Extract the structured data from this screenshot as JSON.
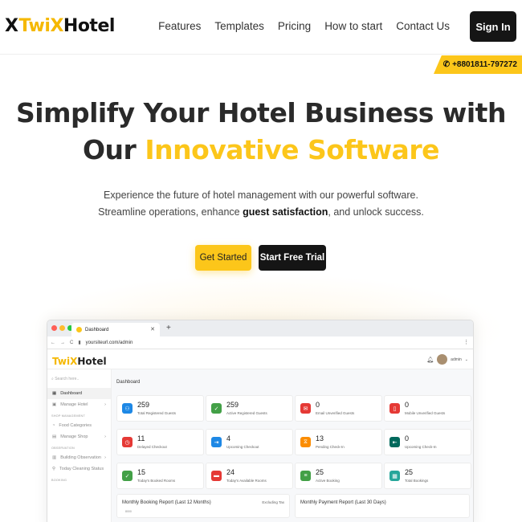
{
  "brand": {
    "logo_mark": "X",
    "logo_twix": "Twi",
    "logo_x": "X",
    "logo_hotel": "Hotel"
  },
  "nav": {
    "items": [
      "Features",
      "Templates",
      "Pricing",
      "How to start",
      "Contact Us"
    ],
    "signin_label": "Sign In"
  },
  "phone": {
    "number": "+8801811-797272",
    "icon": "phone-icon"
  },
  "hero": {
    "title_line1": "Simplify Your Hotel Business with",
    "title_line2_plain": "Our ",
    "title_line2_accent": "Innovative Software",
    "sub_part1": "Experience the future of hotel management with our powerful software. Streamline operations, enhance ",
    "sub_bold": "guest satisfaction",
    "sub_part2": ", and unlock success.",
    "btn_get_started": "Get Started",
    "btn_free_trial": "Start Free Trial"
  },
  "colors": {
    "accent": "#fcc61a",
    "dark": "#151515"
  },
  "browser": {
    "tab_title": "Dashboard",
    "url": "yoursiteurl.com/admin",
    "nav_back": "←",
    "nav_fwd": "→",
    "nav_reload": "C"
  },
  "app": {
    "logo_twix": "TwiX",
    "logo_hotel": "Hotel",
    "user_label": "admin",
    "sidebar": {
      "search_placeholder": "Search here..",
      "dashboard": "Dashboard",
      "manage_hotel": "Manage Hotel",
      "group_shop": "SHOP MANAGEMENT",
      "food_categories": "Food Categories",
      "manage_shop": "Manage Shop",
      "group_observation": "OBSERVATION",
      "building_observation": "Building Observation",
      "today_cleaning": "Today Cleaning Status",
      "group_booking": "BOOKING"
    },
    "breadcrumb": "Dashboard",
    "cards": [
      {
        "value": "259",
        "label": "Total Registered Guests",
        "color": "#1e88e5",
        "icon": "users-icon"
      },
      {
        "value": "259",
        "label": "Active Registered Guests",
        "color": "#43a047",
        "icon": "user-check-icon"
      },
      {
        "value": "0",
        "label": "Email Unverified Guests",
        "color": "#e53935",
        "icon": "mail-icon"
      },
      {
        "value": "0",
        "label": "Mobile Unverified Guests",
        "color": "#e53935",
        "icon": "mobile-icon"
      },
      {
        "value": "11",
        "label": "Delayed Checkout",
        "color": "#e53935",
        "icon": "clock-icon"
      },
      {
        "value": "4",
        "label": "Upcoming Checkout",
        "color": "#1e88e5",
        "icon": "logout-icon"
      },
      {
        "value": "13",
        "label": "Pending Check-In",
        "color": "#fb8c00",
        "icon": "hourglass-icon"
      },
      {
        "value": "0",
        "label": "Upcoming Check-In",
        "color": "#00695c",
        "icon": "login-icon"
      },
      {
        "value": "15",
        "label": "Today's Booked Rooms",
        "color": "#43a047",
        "icon": "check-icon"
      },
      {
        "value": "24",
        "label": "Today's Available Rooms",
        "color": "#e53935",
        "icon": "bed-icon"
      },
      {
        "value": "25",
        "label": "Active Booking",
        "color": "#43a047",
        "icon": "list-icon"
      },
      {
        "value": "25",
        "label": "Total Bookings",
        "color": "#26a69a",
        "icon": "calendar-icon"
      }
    ],
    "report_monthly": "Monthly Booking Report (Last 12 Months)",
    "report_monthly_note": "Excluding Tax",
    "report_monthly_ylabel": "8000",
    "report_payment": "Monthly Payment Report (Last 30 Days)"
  }
}
